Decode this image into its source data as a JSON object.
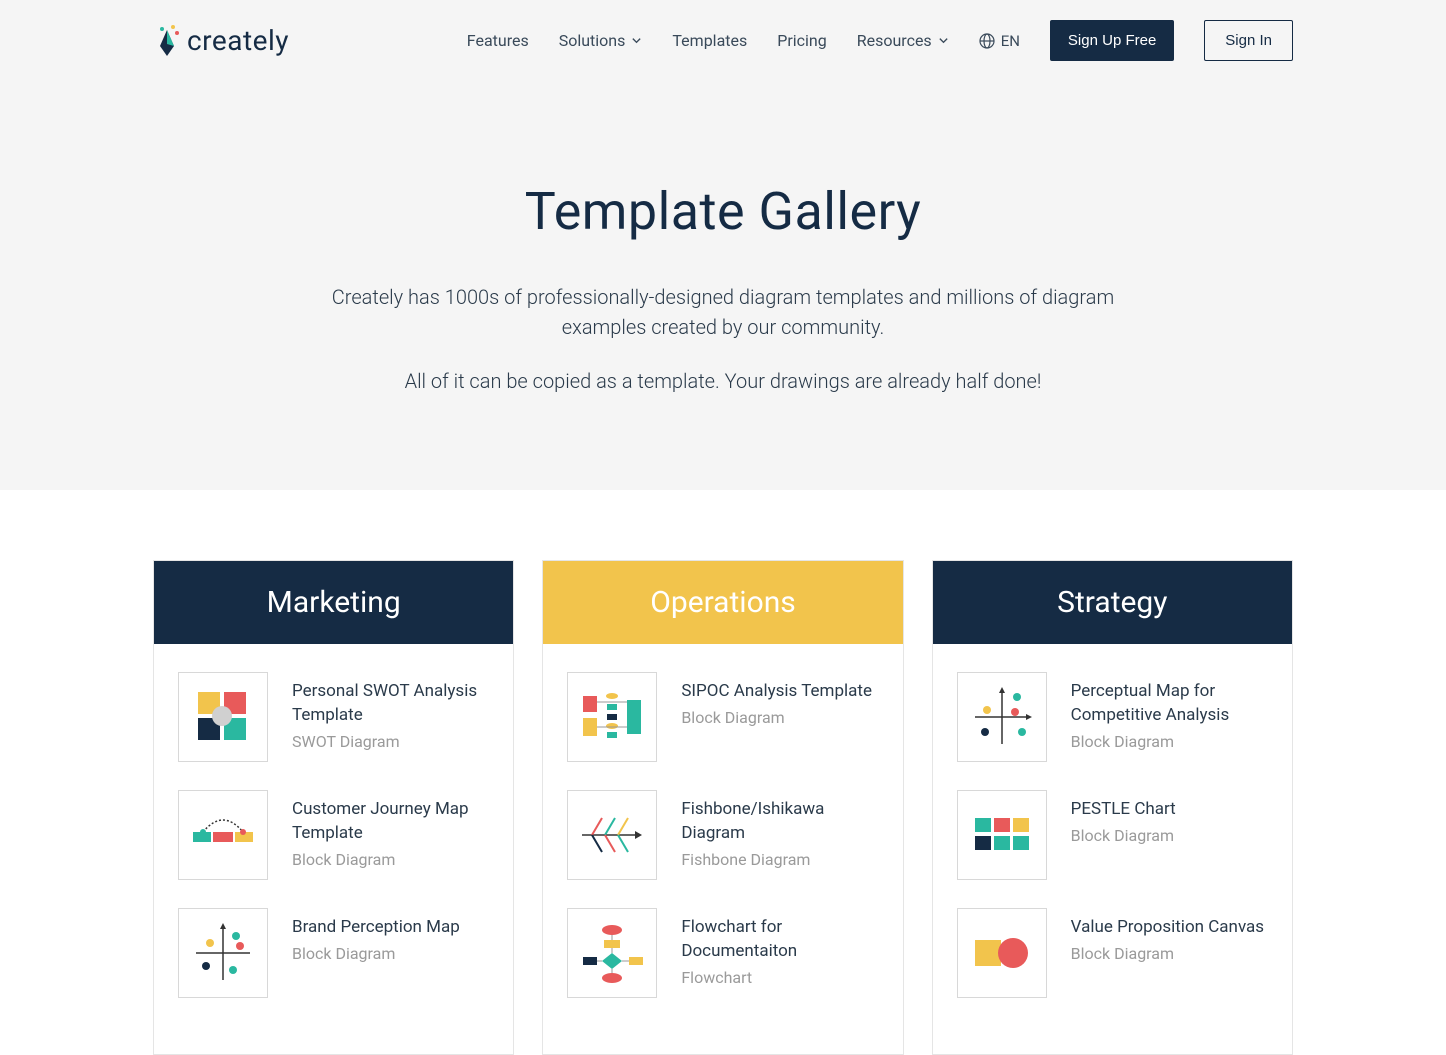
{
  "header": {
    "logo_text": "creately",
    "nav": {
      "features": "Features",
      "solutions": "Solutions",
      "templates": "Templates",
      "pricing": "Pricing",
      "resources": "Resources"
    },
    "lang": "EN",
    "signup": "Sign Up Free",
    "signin": "Sign In"
  },
  "hero": {
    "title": "Template Gallery",
    "desc1": "Creately has 1000s of professionally-designed diagram templates and millions of diagram examples created by our community.",
    "desc2": "All of it can be copied as a template. Your drawings are already half done!"
  },
  "columns": [
    {
      "title": "Marketing",
      "header_style": "dark",
      "items": [
        {
          "title": "Personal SWOT Analysis Template",
          "type": "SWOT Diagram",
          "icon": "swot"
        },
        {
          "title": "Customer Journey Map Template",
          "type": "Block Diagram",
          "icon": "journey"
        },
        {
          "title": "Brand Perception Map",
          "type": "Block Diagram",
          "icon": "perception"
        }
      ]
    },
    {
      "title": "Operations",
      "header_style": "yellow",
      "items": [
        {
          "title": "SIPOC Analysis Template",
          "type": "Block Diagram",
          "icon": "sipoc"
        },
        {
          "title": "Fishbone/Ishikawa Diagram",
          "type": "Fishbone Diagram",
          "icon": "fishbone"
        },
        {
          "title": "Flowchart for Documentaiton",
          "type": "Flowchart",
          "icon": "flowchart"
        }
      ]
    },
    {
      "title": "Strategy",
      "header_style": "dark",
      "items": [
        {
          "title": "Perceptual Map for Competitive Analysis",
          "type": "Block Diagram",
          "icon": "perceptual"
        },
        {
          "title": "PESTLE Chart",
          "type": "Block Diagram",
          "icon": "pestle"
        },
        {
          "title": "Value Proposition Canvas",
          "type": "Block Diagram",
          "icon": "valueprop"
        }
      ]
    }
  ]
}
